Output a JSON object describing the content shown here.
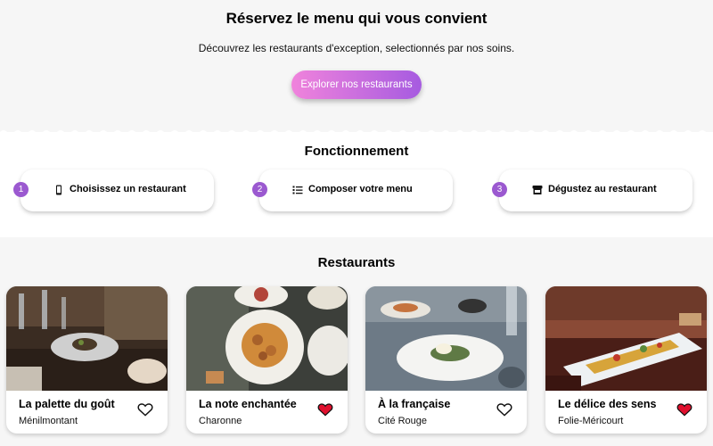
{
  "hero": {
    "title": "Réservez le menu qui vous convient",
    "subtitle": "Découvrez les restaurants d'exception, selectionnés par nos soins.",
    "cta_label": "Explorer nos restaurants"
  },
  "how": {
    "title": "Fonctionnement",
    "steps": [
      {
        "num": "1",
        "label": "Choisissez un restaurant",
        "icon": "phone-icon"
      },
      {
        "num": "2",
        "label": "Composer votre menu",
        "icon": "list-icon"
      },
      {
        "num": "3",
        "label": "Dégustez au restaurant",
        "icon": "store-icon"
      }
    ]
  },
  "restaurants": {
    "title": "Restaurants",
    "items": [
      {
        "name": "La palette du goût",
        "location": "Ménilmontant",
        "favorite": false
      },
      {
        "name": "La note enchantée",
        "location": "Charonne",
        "favorite": true
      },
      {
        "name": "À la française",
        "location": "Cité Rouge",
        "favorite": false
      },
      {
        "name": "Le délice des sens",
        "location": "Folie-Méricourt",
        "favorite": true
      }
    ]
  },
  "colors": {
    "accent": "#9b59d0",
    "heart_active": "#e0102e",
    "cta_start": "#f083dc",
    "cta_end": "#a65be0"
  }
}
